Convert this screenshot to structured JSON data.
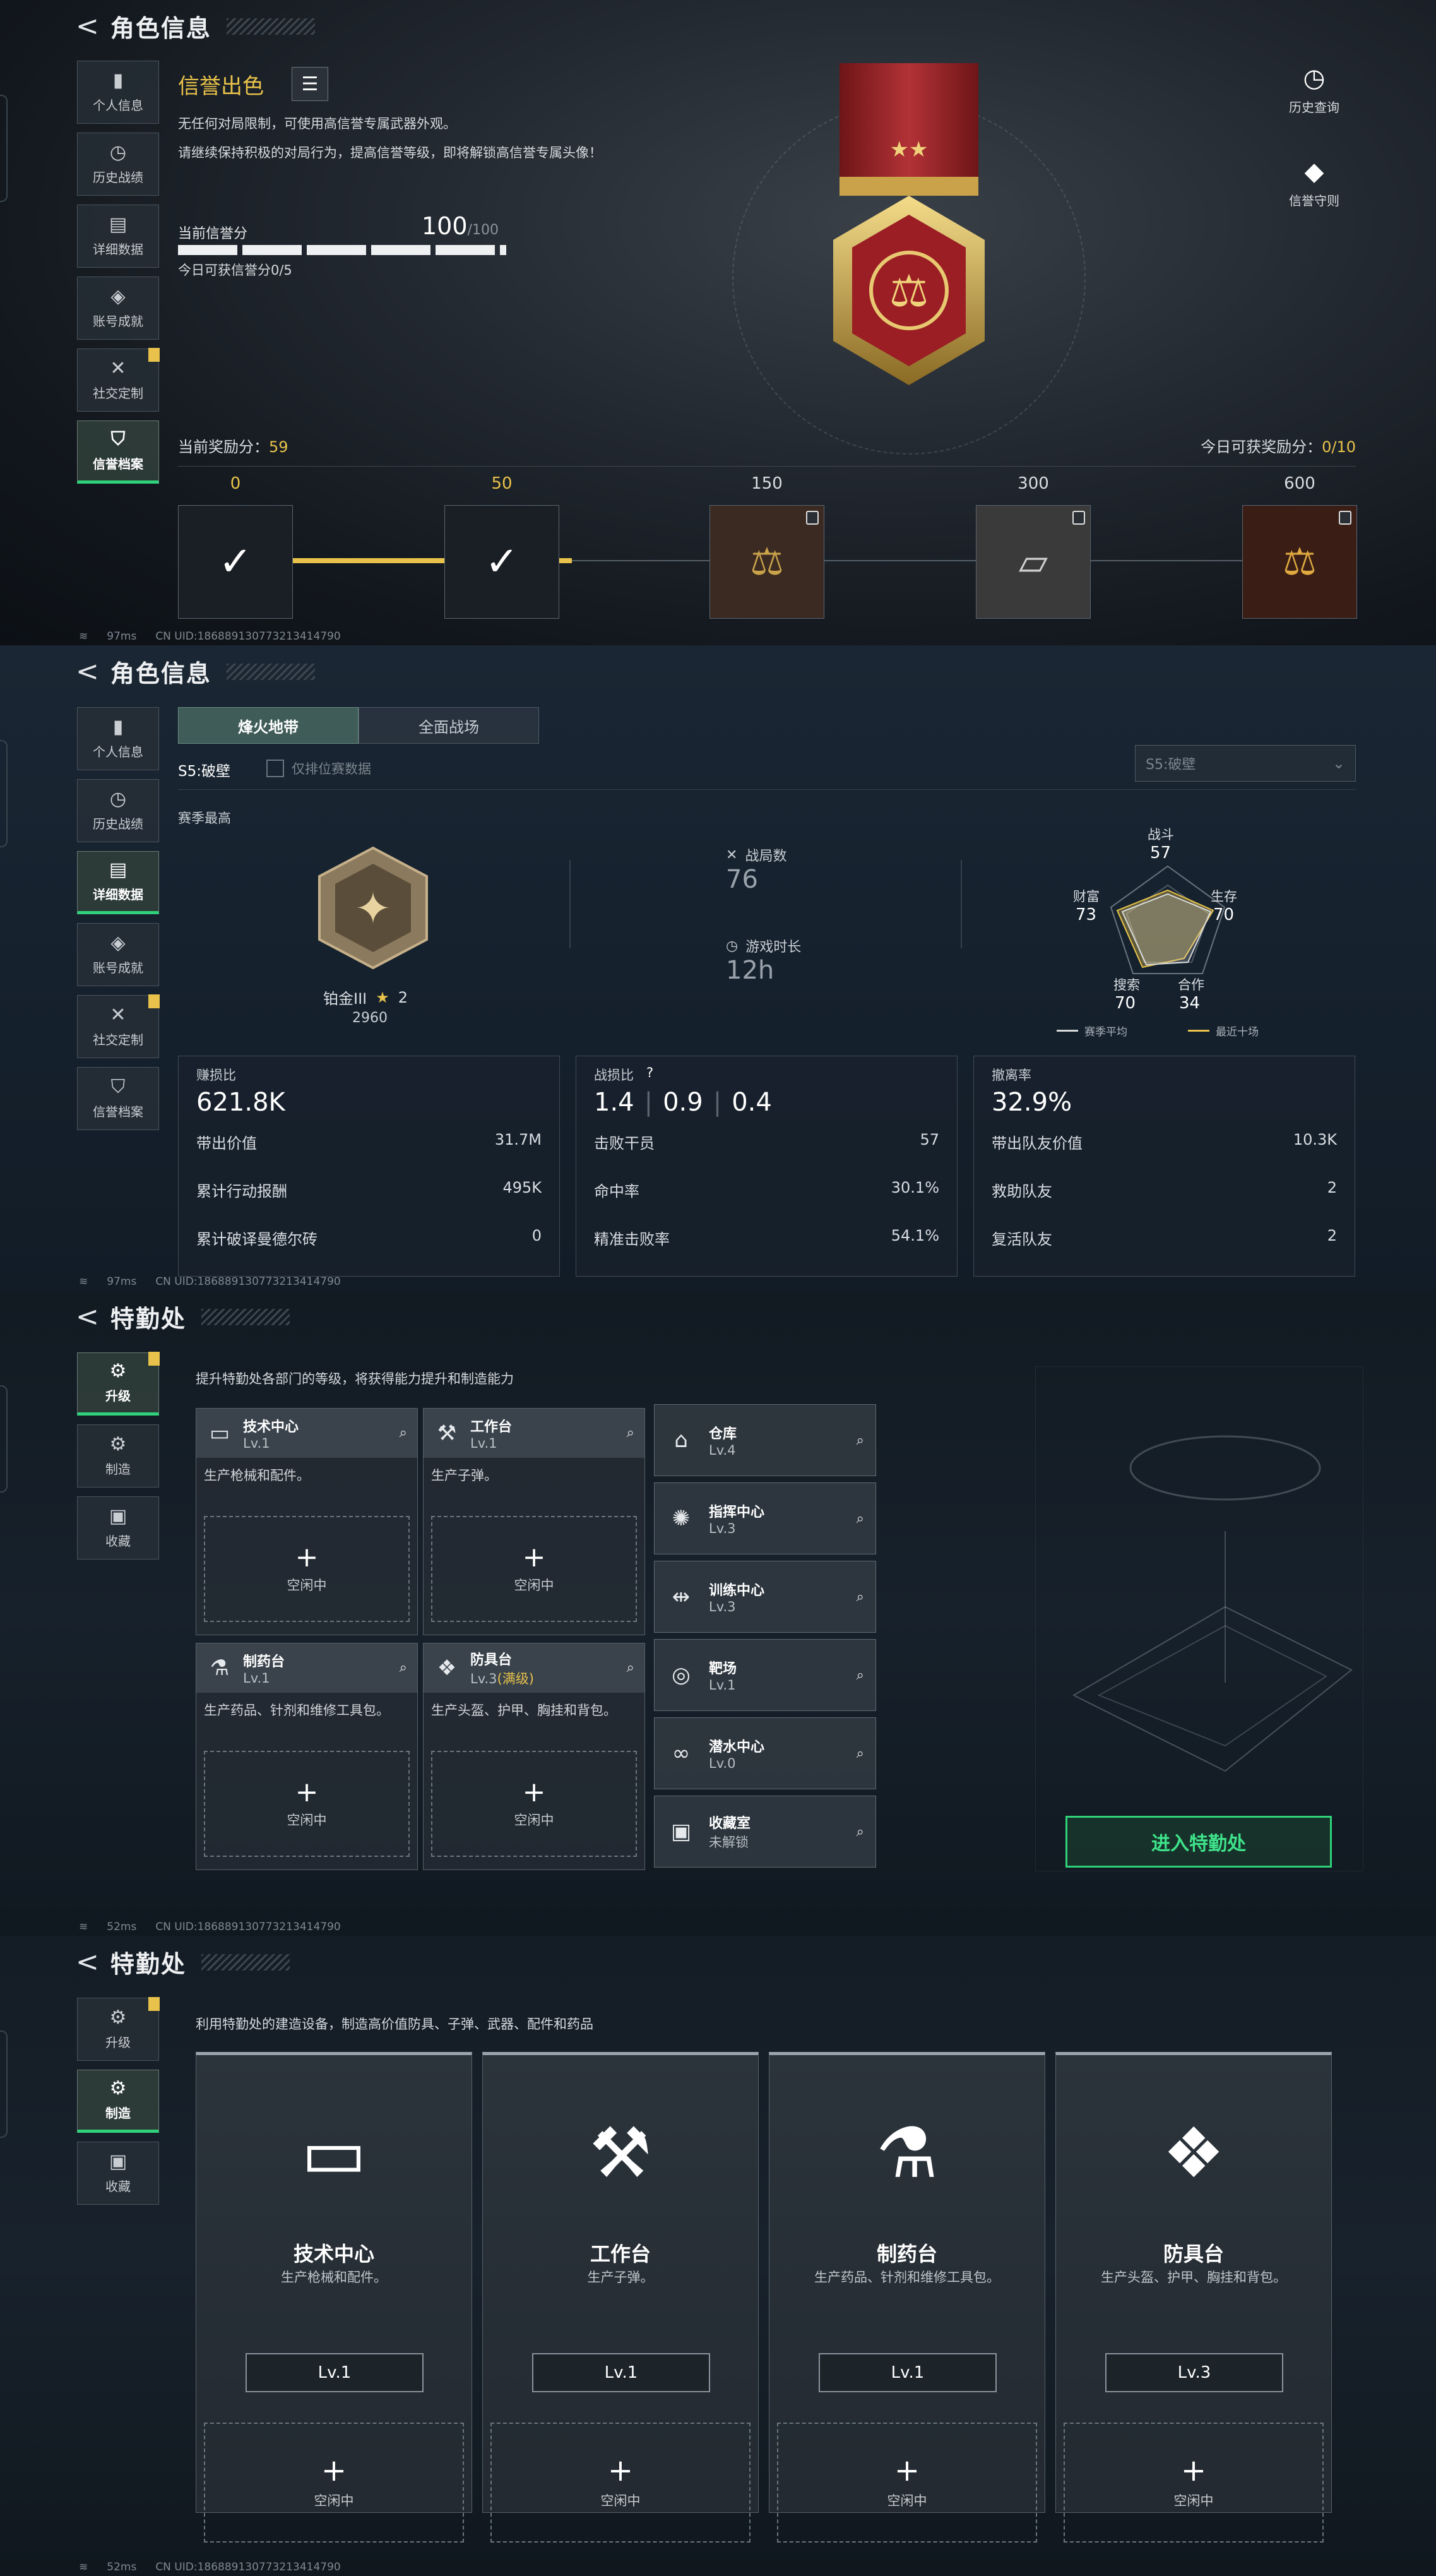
{
  "p1": {
    "back": "<",
    "title": "角色信息",
    "nav": [
      "个人信息",
      "历史战绩",
      "详细数据",
      "账号成就",
      "社交定制",
      "信誉档案"
    ],
    "reputation": {
      "title": "信誉出色",
      "desc1": "无任何对局限制，可使用高信誉专属武器外观。",
      "desc2": "请继续保持积极的对局行为，提高信誉等级，即将解锁高信誉专属头像！",
      "score_label": "当前信誉分",
      "score": "100",
      "score_max": "/100",
      "today_label": "今日可获信誉分0/5"
    },
    "right_buttons": [
      "历史查询",
      "信誉守则"
    ],
    "reward": {
      "current_label": "当前奖励分：",
      "current": "59",
      "today_label": "今日可获奖励分：",
      "today": "0/10"
    },
    "milestones": [
      "0",
      "50",
      "150",
      "300",
      "600"
    ],
    "footer": {
      "ping": "97ms",
      "uid": "CN UID:18688913077321341479​0"
    }
  },
  "p2": {
    "back": "<",
    "title": "角色信息",
    "nav": [
      "个人信息",
      "历史战绩",
      "详细数据",
      "账号成就",
      "社交定制",
      "信誉档案"
    ],
    "tabs": [
      "烽火地带",
      "全面战场"
    ],
    "season": "S5:破壁",
    "checkbox_label": "仅排位赛数据",
    "season_select": "S5:破壁",
    "season_best": "赛季最高",
    "rank_name": "铂金III",
    "rank_stars": "2",
    "rank_score": "2960",
    "battles_label": "战局数",
    "battles": "76",
    "time_label": "游戏时长",
    "time": "12h",
    "radar": {
      "top_label": "战斗",
      "top_val": "57",
      "right_label": "生存",
      "right_val": "70",
      "left_label": "财富",
      "left_val": "73",
      "bl_label": "搜索",
      "bl_val": "70",
      "br_label": "合作",
      "br_val": "34",
      "legend_a": "赛季平均",
      "legend_b": "最近十场"
    },
    "card1": {
      "head": "赚损比",
      "big": "621.8K",
      "rows": [
        [
          "带出价值",
          "31.7M"
        ],
        [
          "累计行动报酬",
          "495K"
        ],
        [
          "累计破译曼德尔砖",
          "0"
        ]
      ]
    },
    "card2": {
      "head": "战损比",
      "q": "?",
      "big1": "1.4",
      "big2": "0.9",
      "big3": "0.4",
      "rows": [
        [
          "击败干员",
          "57"
        ],
        [
          "命中率",
          "30.1%"
        ],
        [
          "精准击败率",
          "54.1%"
        ]
      ]
    },
    "card3": {
      "head": "撤离率",
      "big": "32.9%",
      "rows": [
        [
          "带出队友价值",
          "10.3K"
        ],
        [
          "救助队友",
          "2"
        ],
        [
          "复活队友",
          "2"
        ]
      ]
    },
    "footer": {
      "ping": "97ms",
      "uid": "CN UID:18688913077321341479​0"
    }
  },
  "p3": {
    "back": "<",
    "title": "特勤处",
    "nav": [
      "升级",
      "制造",
      "收藏"
    ],
    "subtitle": "提升特勤处各部门的等级，将获得能力提升和制造能力",
    "big": [
      {
        "name": "技术中心",
        "lv": "Lv.1",
        "desc": "生产枪械和配件。",
        "slot": "空闲中"
      },
      {
        "name": "工作台",
        "lv": "Lv.1",
        "desc": "生产子弹。",
        "slot": "空闲中"
      },
      {
        "name": "制药台",
        "lv": "Lv.1",
        "desc": "生产药品、针剂和维修工具包。",
        "slot": "空闲中"
      },
      {
        "name": "防具台",
        "lv": "Lv.3",
        "max": "(满级)",
        "desc": "生产头盔、护甲、胸挂和背包。",
        "slot": "空闲中"
      }
    ],
    "mini": [
      {
        "name": "仓库",
        "lv": "Lv.4"
      },
      {
        "name": "指挥中心",
        "lv": "Lv.3"
      },
      {
        "name": "训练中心",
        "lv": "Lv.3"
      },
      {
        "name": "靶场",
        "lv": "Lv.1"
      },
      {
        "name": "潜水中心",
        "lv": "Lv.0"
      },
      {
        "name": "收藏室",
        "lv": "未解锁"
      }
    ],
    "enter": "进入特勤处",
    "footer": {
      "ping": "52ms",
      "uid": "CN UID:18688913077321341479​0"
    }
  },
  "p4": {
    "back": "<",
    "title": "特勤处",
    "nav": [
      "升级",
      "制造",
      "收藏"
    ],
    "subtitle": "利用特勤处的建造设备，制造高价值防具、子弹、武器、配件和药品",
    "cards": [
      {
        "name": "技术中心",
        "desc": "生产枪械和配件。",
        "lv": "Lv.1",
        "slot": "空闲中"
      },
      {
        "name": "工作台",
        "desc": "生产子弹。",
        "lv": "Lv.1",
        "slot": "空闲中"
      },
      {
        "name": "制药台",
        "desc": "生产药品、针剂和维修工具包。",
        "lv": "Lv.1",
        "slot": "空闲中"
      },
      {
        "name": "防具台",
        "desc": "生产头盔、护甲、胸挂和背包。",
        "lv": "Lv.3",
        "slot": "空闲中"
      }
    ],
    "footer": {
      "ping": "52ms",
      "uid": "CN UID:18688913077321341479​0"
    }
  }
}
